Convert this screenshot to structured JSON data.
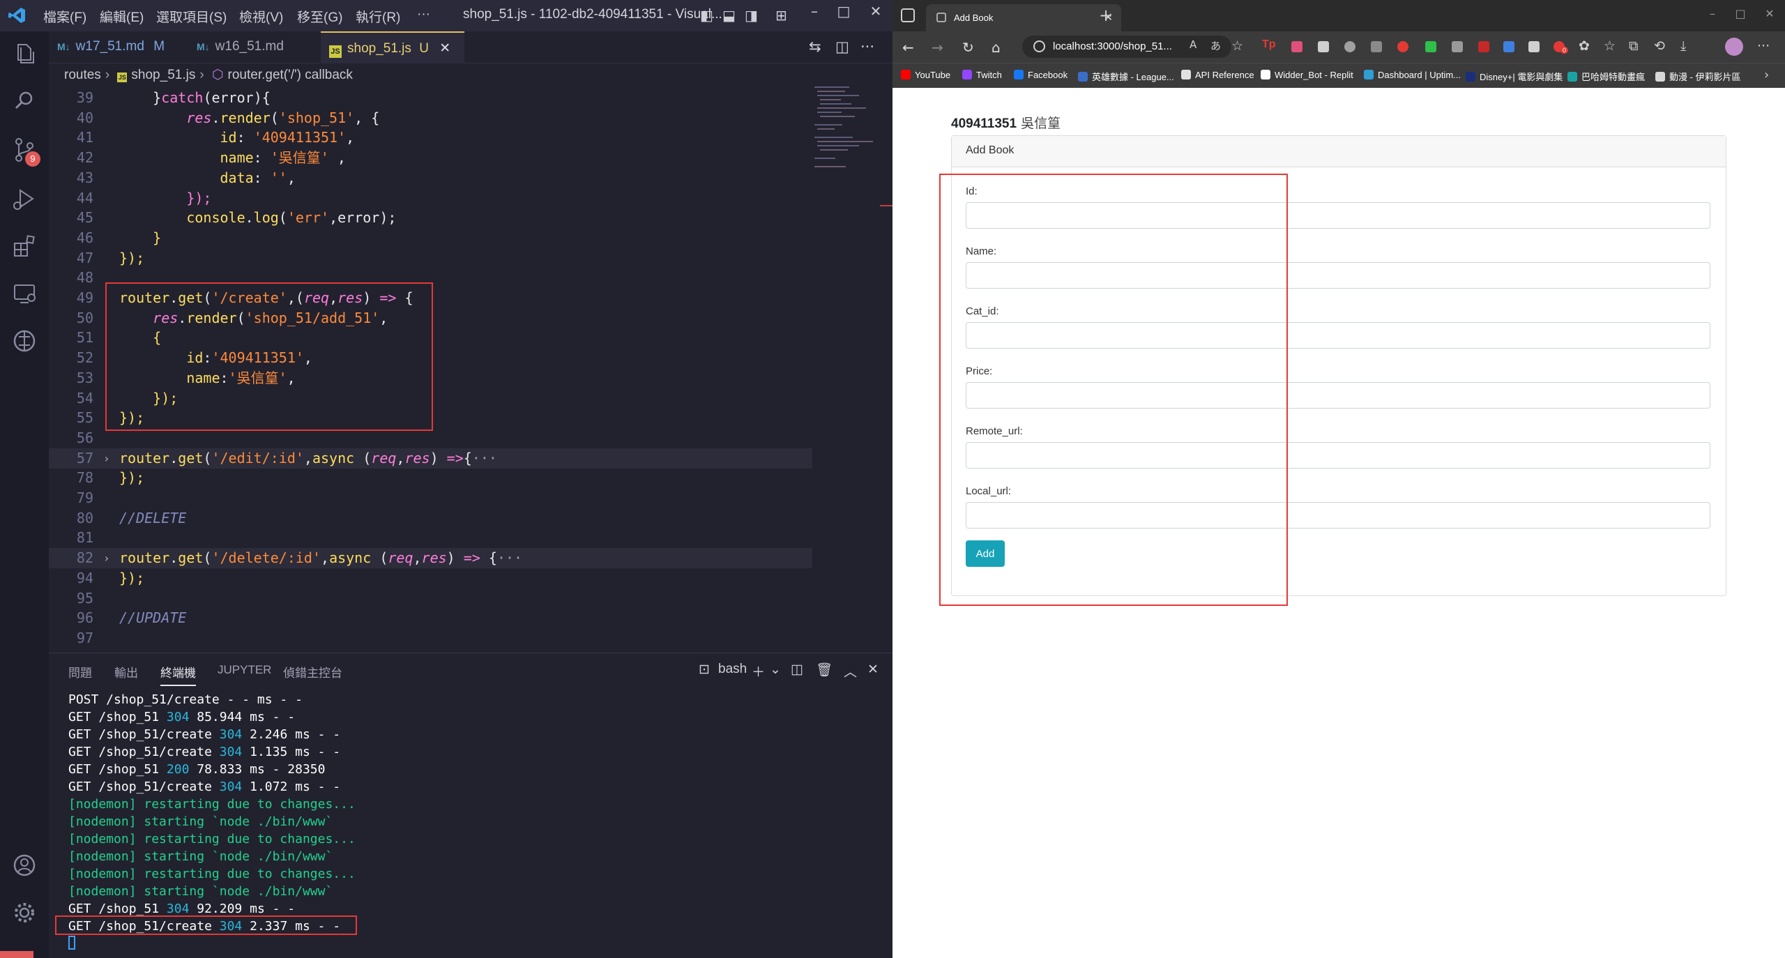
{
  "vscode": {
    "menu": [
      "檔案(F)",
      "編輯(E)",
      "選取項目(S)",
      "檢視(V)",
      "移至(G)",
      "執行(R)",
      "···"
    ],
    "window_title": "shop_51.js - 1102-db2-409411351 - Visual...",
    "scm_badge": "9",
    "tabs": [
      {
        "label": "w17_51.md",
        "status": "M",
        "type": "md"
      },
      {
        "label": "w16_51.md",
        "status": "",
        "type": "md"
      },
      {
        "label": "shop_51.js",
        "status": "U",
        "type": "js"
      }
    ],
    "breadcrumb": [
      "routes",
      "shop_51.js",
      "router.get('/') callback"
    ],
    "panel_tabs": [
      "問題",
      "輸出",
      "終端機",
      "JUPYTER",
      "偵錯主控台"
    ],
    "terminal_shell": "bash",
    "terminal_lines": [
      {
        "text": "POST /shop_51/create - - ms - -",
        "kind": "req"
      },
      {
        "pre": "GET /shop_51 ",
        "status": "304",
        "post": " 85.944 ms - -",
        "kind": "status"
      },
      {
        "pre": "GET /shop_51/create ",
        "status": "304",
        "post": " 2.246 ms - -",
        "kind": "status"
      },
      {
        "pre": "GET /shop_51/create ",
        "status": "304",
        "post": " 1.135 ms - -",
        "kind": "status"
      },
      {
        "pre": "GET /shop_51 ",
        "status": "200",
        "post": " 78.833 ms - 28350",
        "kind": "status"
      },
      {
        "pre": "GET /shop_51/create ",
        "status": "304",
        "post": " 1.072 ms - -",
        "kind": "status"
      },
      {
        "text": "[nodemon] restarting due to changes...",
        "kind": "nodemon"
      },
      {
        "text": "[nodemon] starting `node ./bin/www`",
        "kind": "nodemon"
      },
      {
        "text": "[nodemon] restarting due to changes...",
        "kind": "nodemon"
      },
      {
        "text": "[nodemon] starting `node ./bin/www`",
        "kind": "nodemon"
      },
      {
        "text": "[nodemon] restarting due to changes...",
        "kind": "nodemon"
      },
      {
        "text": "[nodemon] starting `node ./bin/www`",
        "kind": "nodemon"
      },
      {
        "pre": "GET /shop_51 ",
        "status": "304",
        "post": " 92.209 ms - -",
        "kind": "status"
      },
      {
        "pre": "GET /shop_51/create ",
        "status": "304",
        "post": " 2.337 ms - -",
        "kind": "status"
      }
    ],
    "code_lines": [
      {
        "n": "39",
        "tokens": [
          [
            "pl",
            "    }"
          ],
          [
            "kw",
            "catch"
          ],
          [
            "pl",
            "("
          ],
          [
            "var",
            "error"
          ],
          [
            "pl",
            "){"
          ]
        ]
      },
      {
        "n": "40",
        "tokens": [
          [
            "pl",
            "        "
          ],
          [
            "obj",
            "res"
          ],
          [
            "pl",
            "."
          ],
          [
            "fn",
            "render"
          ],
          [
            "pl",
            "("
          ],
          [
            "str",
            "'shop_51'"
          ],
          [
            "pl",
            ", {"
          ]
        ]
      },
      {
        "n": "41",
        "tokens": [
          [
            "pl",
            "            "
          ],
          [
            "prop",
            "id"
          ],
          [
            "pl",
            ": "
          ],
          [
            "str",
            "'409411351'"
          ],
          [
            "pl",
            ","
          ]
        ]
      },
      {
        "n": "42",
        "tokens": [
          [
            "pl",
            "            "
          ],
          [
            "prop",
            "name"
          ],
          [
            "pl",
            ": "
          ],
          [
            "str",
            "'吳信篁'"
          ],
          [
            "pl",
            " ,"
          ]
        ]
      },
      {
        "n": "43",
        "tokens": [
          [
            "pl",
            "            "
          ],
          [
            "prop",
            "data"
          ],
          [
            "pl",
            ": "
          ],
          [
            "str",
            "''"
          ],
          [
            "pl",
            ","
          ]
        ]
      },
      {
        "n": "44",
        "tokens": [
          [
            "pl",
            "        "
          ],
          [
            "kw",
            "});"
          ]
        ]
      },
      {
        "n": "45",
        "tokens": [
          [
            "pl",
            "        "
          ],
          [
            "fn",
            "console"
          ],
          [
            "pl",
            "."
          ],
          [
            "fn",
            "log"
          ],
          [
            "pl",
            "("
          ],
          [
            "str",
            "'err'"
          ],
          [
            "pl",
            ","
          ],
          [
            "var",
            "error"
          ],
          [
            "pl",
            ");"
          ]
        ]
      },
      {
        "n": "46",
        "tokens": [
          [
            "pl",
            "    "
          ],
          [
            "fn",
            "}"
          ]
        ]
      },
      {
        "n": "47",
        "tokens": [
          [
            "fn",
            "});"
          ]
        ]
      },
      {
        "n": "48",
        "tokens": []
      },
      {
        "n": "49",
        "tokens": [
          [
            "fn",
            "router"
          ],
          [
            "pl",
            "."
          ],
          [
            "fn",
            "get"
          ],
          [
            "pl",
            "("
          ],
          [
            "str",
            "'/create'"
          ],
          [
            "pl",
            ",("
          ],
          [
            "itv",
            "req"
          ],
          [
            "pl",
            ","
          ],
          [
            "itv",
            "res"
          ],
          [
            "pl",
            ") "
          ],
          [
            "kw",
            "=>"
          ],
          [
            "pl",
            " {"
          ]
        ]
      },
      {
        "n": "50",
        "tokens": [
          [
            "pl",
            "    "
          ],
          [
            "obj",
            "res"
          ],
          [
            "pl",
            "."
          ],
          [
            "fn",
            "render"
          ],
          [
            "pl",
            "("
          ],
          [
            "str",
            "'shop_51/add_51'"
          ],
          [
            "pl",
            ","
          ]
        ]
      },
      {
        "n": "51",
        "tokens": [
          [
            "pl",
            "    "
          ],
          [
            "fn",
            "{"
          ]
        ]
      },
      {
        "n": "52",
        "tokens": [
          [
            "pl",
            "        "
          ],
          [
            "prop",
            "id"
          ],
          [
            "pl",
            ":"
          ],
          [
            "str",
            "'409411351'"
          ],
          [
            "pl",
            ","
          ]
        ]
      },
      {
        "n": "53",
        "tokens": [
          [
            "pl",
            "        "
          ],
          [
            "prop",
            "name"
          ],
          [
            "pl",
            ":"
          ],
          [
            "str",
            "'吳信篁'"
          ],
          [
            "pl",
            ","
          ]
        ]
      },
      {
        "n": "54",
        "tokens": [
          [
            "pl",
            "    "
          ],
          [
            "fn",
            "});"
          ]
        ]
      },
      {
        "n": "55",
        "tokens": [
          [
            "fn",
            "});"
          ]
        ]
      },
      {
        "n": "56",
        "tokens": []
      },
      {
        "n": "57",
        "folded": true,
        "tokens": [
          [
            "fn",
            "router"
          ],
          [
            "pl",
            "."
          ],
          [
            "fn",
            "get"
          ],
          [
            "pl",
            "("
          ],
          [
            "str",
            "'/edit/:id'"
          ],
          [
            "pl",
            ","
          ],
          [
            "fn",
            "async"
          ],
          [
            "pl",
            " ("
          ],
          [
            "itv",
            "req"
          ],
          [
            "pl",
            ","
          ],
          [
            "itv",
            "res"
          ],
          [
            "pl",
            ") "
          ],
          [
            "kw",
            "=>"
          ],
          [
            "pl",
            "{"
          ],
          [
            "ell",
            "···"
          ]
        ]
      },
      {
        "n": "78",
        "tokens": [
          [
            "fn",
            "});"
          ]
        ]
      },
      {
        "n": "79",
        "tokens": []
      },
      {
        "n": "80",
        "tokens": [
          [
            "cm",
            "//DELETE"
          ]
        ]
      },
      {
        "n": "81",
        "tokens": []
      },
      {
        "n": "82",
        "folded": true,
        "tokens": [
          [
            "fn",
            "router"
          ],
          [
            "pl",
            "."
          ],
          [
            "fn",
            "get"
          ],
          [
            "pl",
            "("
          ],
          [
            "str",
            "'/delete/:id'"
          ],
          [
            "pl",
            ","
          ],
          [
            "fn",
            "async"
          ],
          [
            "pl",
            " ("
          ],
          [
            "itv",
            "req"
          ],
          [
            "pl",
            ","
          ],
          [
            "itv",
            "res"
          ],
          [
            "pl",
            ") "
          ],
          [
            "kw",
            "=>"
          ],
          [
            "pl",
            " {"
          ],
          [
            "ell",
            "···"
          ]
        ]
      },
      {
        "n": "94",
        "tokens": [
          [
            "fn",
            "});"
          ]
        ]
      },
      {
        "n": "95",
        "tokens": []
      },
      {
        "n": "96",
        "tokens": [
          [
            "cm",
            "//UPDATE"
          ]
        ]
      },
      {
        "n": "97",
        "tokens": []
      }
    ]
  },
  "browser": {
    "tab_title": "Add Book",
    "url": "localhost:3000/shop_51...",
    "bookmarks": [
      "YouTube",
      "Twitch",
      "Facebook",
      "英雄數據 - League...",
      "API Reference",
      "Widder_Bot - Replit",
      "Dashboard | Uptim...",
      "Disney+| 電影與劇集",
      "巴哈姆特動畫瘋",
      "動漫 - 伊莉影片區"
    ],
    "bookmark_colors": [
      "#ff0000",
      "#9146ff",
      "#1877f2",
      "#3a6ec8",
      "#e0e0e0",
      "#ffffff",
      "#2f9ed3",
      "#1b2e7a",
      "#1aa3a3",
      "#d9d9d9"
    ],
    "extension_badge": "0"
  },
  "page": {
    "heading_id": "409411351",
    "heading_name": "吳信篁",
    "card_title": "Add Book",
    "fields": [
      "Id:",
      "Name:",
      "Cat_id:",
      "Price:",
      "Remote_url:",
      "Local_url:"
    ],
    "submit_label": "Add"
  },
  "colors": {
    "accent_button": "#17a2b8",
    "highlight_box": "#e53935"
  }
}
